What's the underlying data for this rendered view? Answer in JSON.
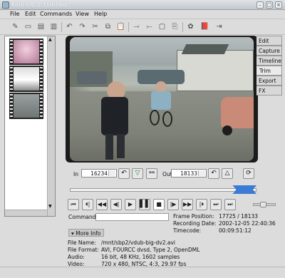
{
  "window": {
    "title": "Kino 0.6.3: Untitled *"
  },
  "menu": [
    "File",
    "Edit",
    "Commands",
    "View",
    "Help"
  ],
  "toolbar_icons": [
    "new-icon",
    "open-icon",
    "save-icon",
    "save-as-icon",
    "undo-icon",
    "redo-icon",
    "cut-icon",
    "copy-icon",
    "paste-icon",
    "split-icon",
    "join-icon",
    "remove-icon",
    "attach-icon",
    "preferences-icon",
    "help-icon",
    "exit-icon"
  ],
  "tabs": [
    "Edit",
    "Capture",
    "Timeline",
    "Trim",
    "Export",
    "FX"
  ],
  "selected_tab": "Trim",
  "trim": {
    "in_label": "In",
    "in_value": "16234",
    "out_label": "Out",
    "out_value": "18133"
  },
  "command": {
    "label": "Command",
    "value": ""
  },
  "frame_info": {
    "position_label": "Frame Position:",
    "position_value": "17725 / 18133",
    "date_label": "Recording Date:",
    "date_value": "2002-12-05 22:40:36",
    "timecode_label": "Timecode:",
    "timecode_value": "00:09:51:12"
  },
  "more_info": {
    "label": "More Info",
    "file_name_label": "File Name:",
    "file_name_value": "/mnt/sbp2/vdub-big-dv2.avi",
    "file_format_label": "File Format:",
    "file_format_value": "AVI, FOURCC dvsd, Type 2, OpenDML",
    "audio_label": "Audio:",
    "audio_value": "16 bit, 48 KHz, 1602 samples",
    "video_label": "Video:",
    "video_value": "720 x 480, NTSC, 4:3, 29.97 fps"
  },
  "trim_slider": {
    "in_fraction": 0.895,
    "out_fraction": 1.0,
    "position_fraction": 0.977
  },
  "colors": {
    "tab_selected": "#eaeaea",
    "background": "#dcdcdc",
    "slider_marker": "#3a7bd5"
  }
}
